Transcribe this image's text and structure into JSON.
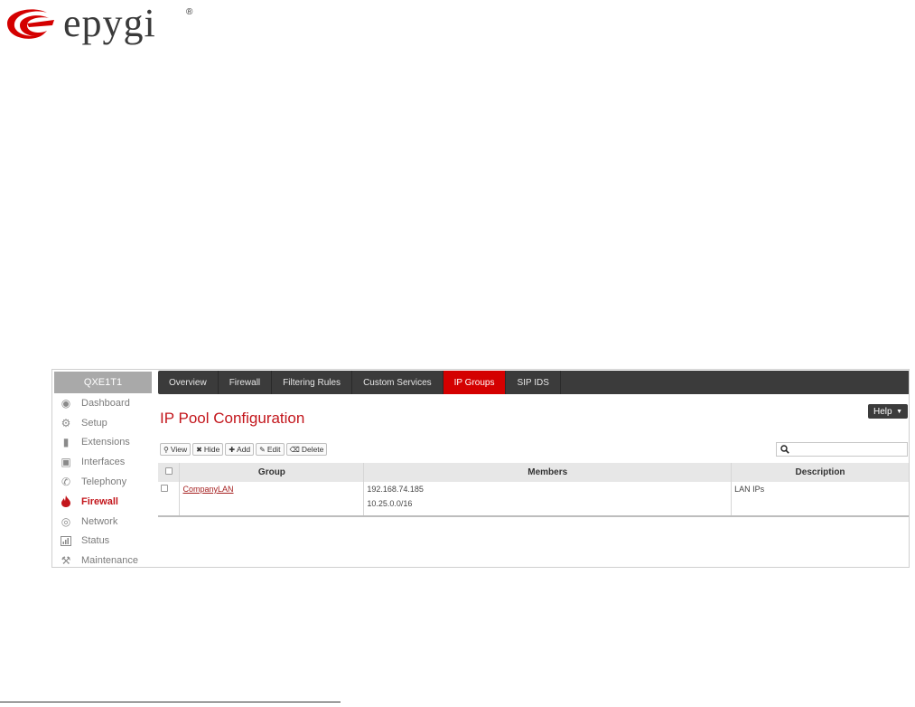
{
  "logo": {
    "text": "epygi",
    "reg": "®"
  },
  "sidebar": {
    "device": "QXE1T1",
    "items": [
      {
        "label": "Dashboard",
        "icon": "dashboard-icon",
        "active": false
      },
      {
        "label": "Setup",
        "icon": "gear-icon",
        "active": false
      },
      {
        "label": "Extensions",
        "icon": "book-icon",
        "active": false
      },
      {
        "label": "Interfaces",
        "icon": "interfaces-icon",
        "active": false
      },
      {
        "label": "Telephony",
        "icon": "phone-icon",
        "active": false
      },
      {
        "label": "Firewall",
        "icon": "flame-icon",
        "active": true
      },
      {
        "label": "Network",
        "icon": "globe-icon",
        "active": false
      },
      {
        "label": "Status",
        "icon": "chart-icon",
        "active": false
      },
      {
        "label": "Maintenance",
        "icon": "wrench-icon",
        "active": false
      }
    ]
  },
  "tabs": [
    {
      "label": "Overview",
      "active": false
    },
    {
      "label": "Firewall",
      "active": false
    },
    {
      "label": "Filtering Rules",
      "active": false
    },
    {
      "label": "Custom Services",
      "active": false
    },
    {
      "label": "IP Groups",
      "active": true
    },
    {
      "label": "SIP IDS",
      "active": false
    }
  ],
  "help": {
    "label": "Help"
  },
  "page_title": "IP Pool Configuration",
  "toolbar": {
    "view": "View",
    "hide": "Hide",
    "add": "Add",
    "edit": "Edit",
    "delete": "Delete"
  },
  "search": {
    "placeholder": ""
  },
  "table": {
    "headers": {
      "group": "Group",
      "members": "Members",
      "description": "Description"
    },
    "rows": [
      {
        "group": "CompanyLAN",
        "member1": "192.168.74.185",
        "member2": "10.25.0.0/16",
        "description": "LAN IPs"
      }
    ]
  },
  "colors": {
    "accent": "#c3161c",
    "nav": "#3b3b3b",
    "active_tab": "#d40000"
  }
}
